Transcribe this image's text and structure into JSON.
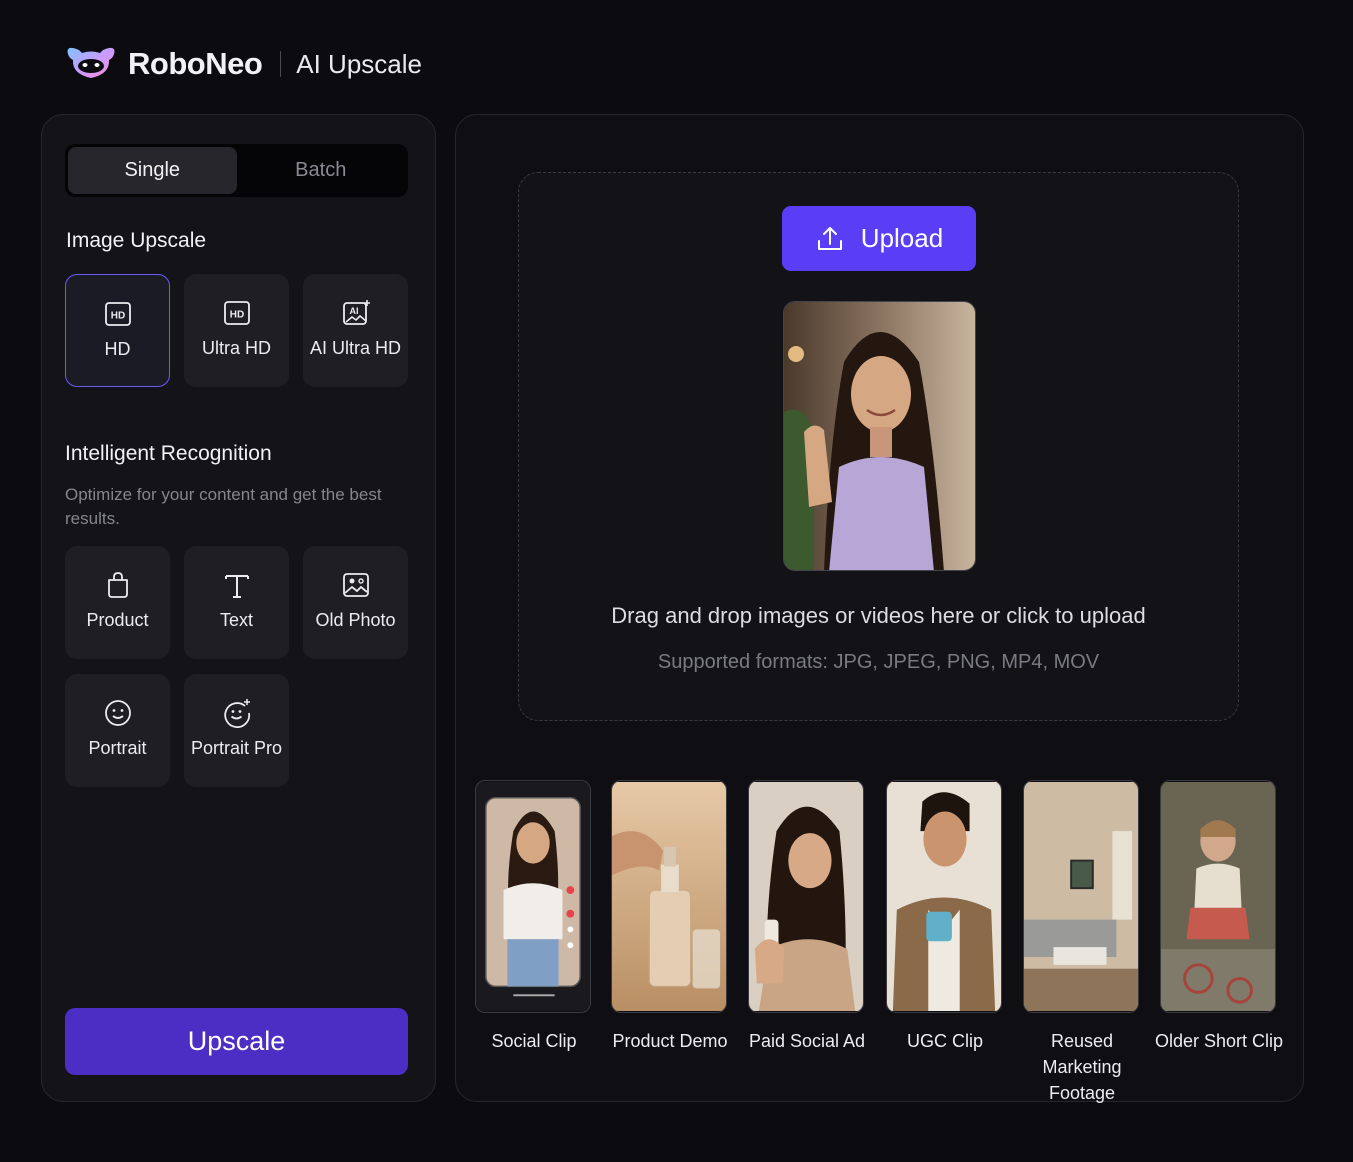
{
  "header": {
    "brand": "RoboNeo",
    "product": "AI Upscale"
  },
  "mode_tabs": [
    {
      "label": "Single",
      "active": true
    },
    {
      "label": "Batch",
      "active": false
    }
  ],
  "image_upscale": {
    "title": "Image Upscale",
    "options": [
      {
        "label": "HD",
        "icon": "hd-icon",
        "selected": true
      },
      {
        "label": "Ultra HD",
        "icon": "hd-icon",
        "selected": false
      },
      {
        "label": "AI Ultra HD",
        "icon": "ai-image-icon",
        "selected": false
      }
    ]
  },
  "recognition": {
    "title": "Intelligent Recognition",
    "description": "Optimize for your content and get the best results.",
    "options": [
      {
        "label": "Product",
        "icon": "shopping-bag-icon"
      },
      {
        "label": "Text",
        "icon": "text-icon"
      },
      {
        "label": "Old Photo",
        "icon": "photo-icon"
      },
      {
        "label": "Portrait",
        "icon": "smile-face-icon"
      },
      {
        "label": "Portrait Pro",
        "icon": "sparkle-face-icon"
      }
    ]
  },
  "upscale_button": "Upscale",
  "upload": {
    "button": "Upload",
    "drop_text": "Drag and drop images or videos here or click to upload",
    "formats": "Supported formats: JPG, JPEG, PNG, MP4, MOV"
  },
  "samples": [
    {
      "label": "Social Clip"
    },
    {
      "label": "Product Demo"
    },
    {
      "label": "Paid Social Ad"
    },
    {
      "label": "UGC Clip"
    },
    {
      "label": "Reused Marketing Footage"
    },
    {
      "label": "Older Short Clip"
    }
  ],
  "colors": {
    "accent": "#5a3ef6",
    "upscale_button": "#4b2fc4",
    "selected_border": "#6a5cf6"
  }
}
